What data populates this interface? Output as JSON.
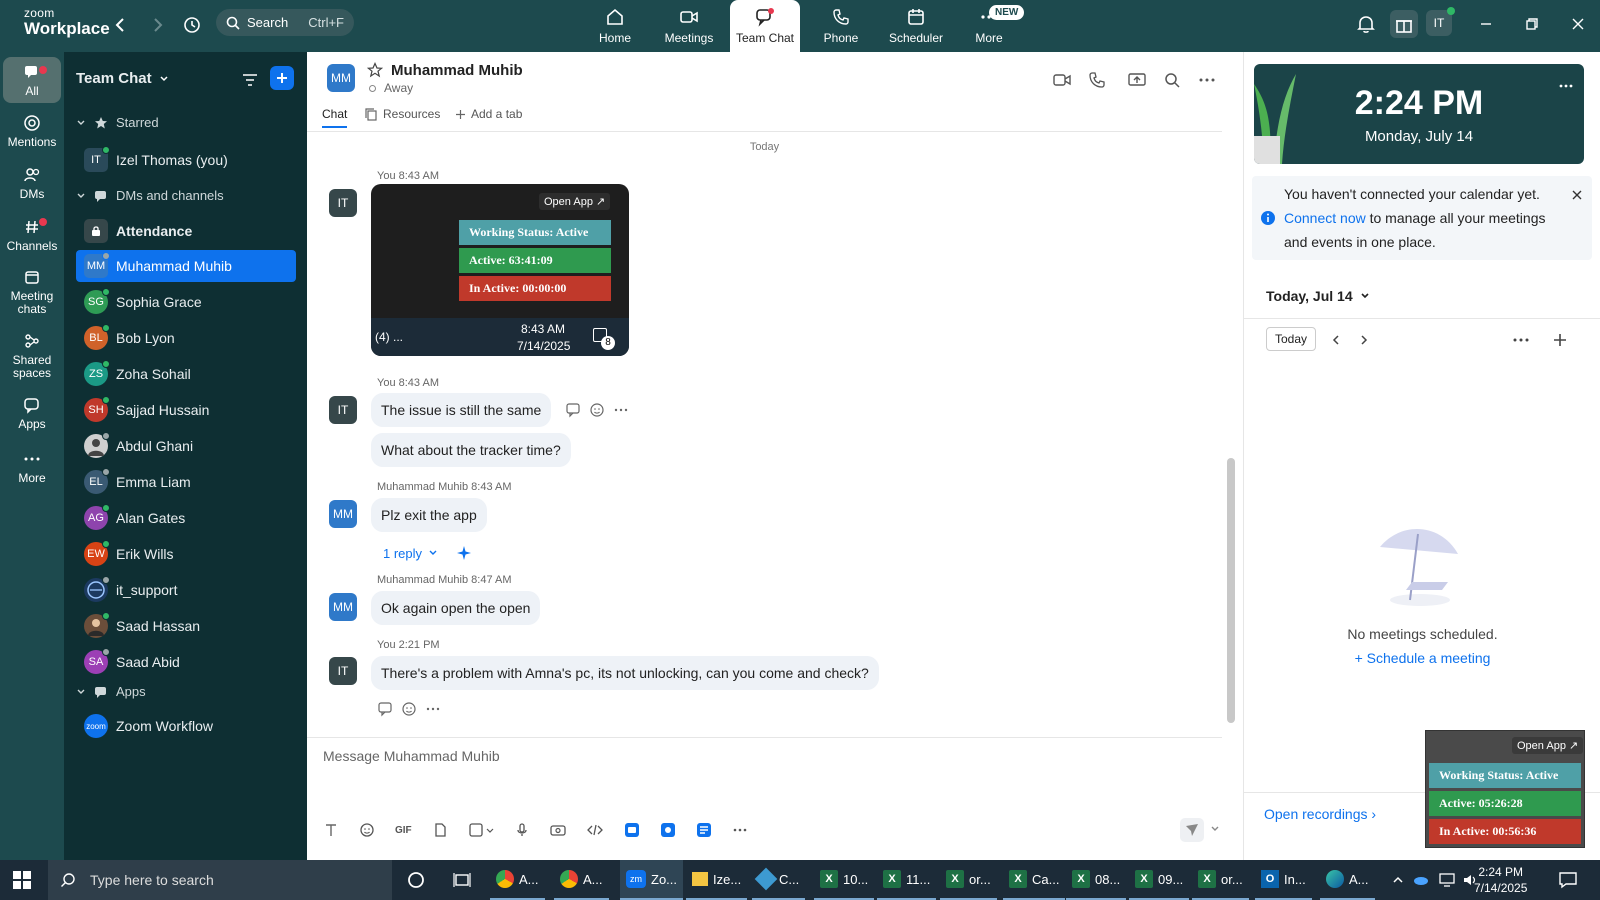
{
  "app": {
    "logo_line1": "zoom",
    "logo_line2": "Workplace"
  },
  "topbar": {
    "search_label": "Search",
    "search_shortcut": "Ctrl+F",
    "tabs": [
      {
        "label": "Home",
        "icon": "home-icon"
      },
      {
        "label": "Meetings",
        "icon": "video-icon"
      },
      {
        "label": "Team Chat",
        "icon": "chat-icon",
        "active": true
      },
      {
        "label": "Phone",
        "icon": "phone-icon"
      },
      {
        "label": "Scheduler",
        "icon": "calendar-icon"
      },
      {
        "label": "More",
        "icon": "more-icon",
        "badge": "NEW"
      }
    ],
    "user_initials": "IT"
  },
  "rail": {
    "items": [
      {
        "label": "All"
      },
      {
        "label": "Mentions"
      },
      {
        "label": "DMs"
      },
      {
        "label": "Channels"
      },
      {
        "label": "Meeting chats"
      },
      {
        "label": "Shared spaces"
      },
      {
        "label": "Apps"
      },
      {
        "label": "More"
      }
    ]
  },
  "sidebar": {
    "title": "Team Chat",
    "sections": {
      "starred": "Starred",
      "dms": "DMs and channels",
      "apps": "Apps"
    },
    "starred": [
      {
        "name": "Izel Thomas (you)",
        "initials": "IT",
        "color": "#2a4a5a"
      }
    ],
    "contacts": [
      {
        "name": "Attendance",
        "initials": "",
        "color": "#36474a"
      },
      {
        "name": "Muhammad Muhib",
        "initials": "MM",
        "color": "#2f79c9"
      },
      {
        "name": "Sophia Grace",
        "initials": "SG",
        "color": "#2e9b55"
      },
      {
        "name": "Bob Lyon",
        "initials": "BL",
        "color": "#d0622a"
      },
      {
        "name": "Zoha Sohail",
        "initials": "ZS",
        "color": "#1b9a86"
      },
      {
        "name": "Sajjad Hussain",
        "initials": "SH",
        "color": "#c0392b"
      },
      {
        "name": "Abdul Ghani",
        "initials": "",
        "color": "#cfcfcf"
      },
      {
        "name": "Emma Liam",
        "initials": "EL",
        "color": "#3a5a73"
      },
      {
        "name": "Alan Gates",
        "initials": "AG",
        "color": "#8e44ad"
      },
      {
        "name": "Erik Wills",
        "initials": "EW",
        "color": "#d84315"
      },
      {
        "name": "it_support",
        "initials": "",
        "color": "#1c3a60"
      },
      {
        "name": "Saad Hassan",
        "initials": "",
        "color": "#6b4e3a"
      },
      {
        "name": "Saad Abid",
        "initials": "SA",
        "color": "#9c3fb5"
      }
    ],
    "apps": [
      {
        "name": "Zoom Workflow",
        "initials": "zoom",
        "color": "#0e72ed"
      }
    ]
  },
  "chat": {
    "name": "Muhammad Muhib",
    "initials": "MM",
    "status": "Away",
    "tabs": {
      "chat": "Chat",
      "resources": "Resources",
      "add": "Add a tab"
    },
    "date_divider": "Today",
    "messages": [
      {
        "meta": "You 8:43 AM"
      },
      {
        "meta": "You 8:43 AM",
        "texts": [
          "The issue is still the same",
          "What about the tracker time?"
        ]
      },
      {
        "meta": "Muhammad Muhib 8:43 AM",
        "texts": [
          "Plz exit the app"
        ],
        "reply": "1 reply"
      },
      {
        "meta": "Muhammad Muhib 8:47 AM",
        "texts": [
          "Ok again open the open"
        ]
      },
      {
        "meta": "You 2:21 PM",
        "texts": [
          "There's a problem with Amna's pc, its not unlocking, can you come and check?"
        ]
      }
    ],
    "my_initials": "IT",
    "composer_placeholder": "Message Muhammad Muhib",
    "composer_gif": "GIF"
  },
  "embedded_shot": {
    "open_app": "Open App ↗",
    "working_status": "Working Status: Active",
    "active": "Active: 63:41:09",
    "inactive": "In Active: 00:00:00",
    "taskbar_label": "(4) ...",
    "time": "8:43 AM",
    "date": "7/14/2025",
    "badge": "8"
  },
  "rpanel": {
    "clock_time": "2:24 PM",
    "clock_date": "Monday, July 14",
    "cal_note_pre": "You haven't connected your calendar yet.",
    "cal_note_link": "Connect now",
    "cal_note_post": "to manage all your meetings and events in one place.",
    "today_label": "Today, Jul 14",
    "today_button": "Today",
    "no_meetings": "No meetings scheduled.",
    "schedule": "Schedule a meeting",
    "open_recordings": "Open recordings"
  },
  "widget": {
    "open_app": "Open App ↗",
    "working_status": "Working Status: Active",
    "active": "Active: 05:26:28",
    "inactive": "In Active: 00:56:36"
  },
  "taskbar": {
    "search": "Type here to search",
    "apps": [
      "A...",
      "A...",
      "Zo...",
      "Ize...",
      "C...",
      "10...",
      "11...",
      "or...",
      "Ca...",
      "08...",
      "09...",
      "or...",
      "In...",
      "A..."
    ],
    "time": "2:24 PM",
    "date": "7/14/2025"
  },
  "colors": {
    "accent": "#0e72ed",
    "topbar": "#1d4a4e",
    "sidebar": "#0e2f33"
  }
}
